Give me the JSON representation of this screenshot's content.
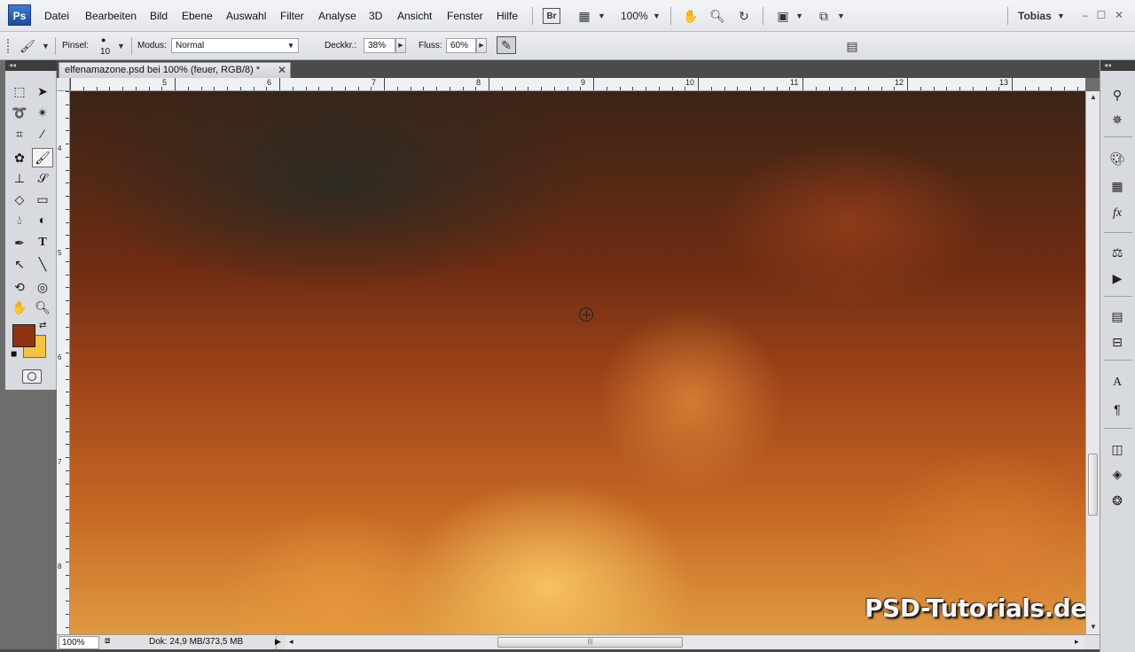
{
  "app": {
    "logo": "Ps",
    "menu": [
      "Datei",
      "Bearbeiten",
      "Bild",
      "Ebene",
      "Auswahl",
      "Filter",
      "Analyse",
      "3D",
      "Ansicht",
      "Fenster",
      "Hilfe"
    ],
    "bridge_label": "Br",
    "zoom_value": "100%",
    "user": "Tobias",
    "user_caret": "▼"
  },
  "options": {
    "brush_label": "Pinsel:",
    "brush_size": "10",
    "mode_label": "Modus:",
    "mode_value": "Normal",
    "opacity_label": "Deckkr.:",
    "opacity_value": "38%",
    "flow_label": "Fluss:",
    "flow_value": "60%"
  },
  "document": {
    "tab_title": "elfenamazone.psd bei 100% (feuer, RGB/8) *",
    "close_glyph": "✕"
  },
  "rulers": {
    "horizontal": [
      "5",
      "6",
      "7",
      "8",
      "9",
      "10",
      "11",
      "12",
      "13"
    ],
    "vertical": [
      "4",
      "5",
      "6",
      "7",
      "8"
    ]
  },
  "canvas": {
    "watermark": "PSD-Tutorials.de"
  },
  "status": {
    "zoom": "100%",
    "doc_info": "Dok: 24,9 MB/373,5 MB"
  },
  "colors": {
    "foreground": "#8e3312",
    "background": "#f5c242"
  },
  "scroll": {
    "vertical_position": 0.77,
    "vertical_size": 0.12,
    "horizontal_position": 0.34,
    "horizontal_size": 0.24
  },
  "icons": {
    "tools": [
      "marquee-icon",
      "move-icon",
      "lasso-icon",
      "magic-wand-icon",
      "crop-icon",
      "eyedropper-icon",
      "healing-icon",
      "brush-icon",
      "stamp-icon",
      "history-brush-icon",
      "eraser-icon",
      "gradient-icon",
      "blur-icon",
      "dodge-icon",
      "pen-icon",
      "type-icon",
      "path-select-icon",
      "line-icon",
      "3d-rotate-icon",
      "3d-orbit-icon",
      "hand-icon",
      "zoom-icon"
    ],
    "dock": [
      "tool-presets-icon",
      "navigator-icon",
      "color-icon",
      "swatches-icon",
      "styles-icon",
      "adjustments-icon",
      "actions-icon",
      "animation-icon",
      "measurement-icon",
      "character-icon",
      "paragraph-icon",
      "masks-icon",
      "layers-icon",
      "channels-icon"
    ]
  }
}
